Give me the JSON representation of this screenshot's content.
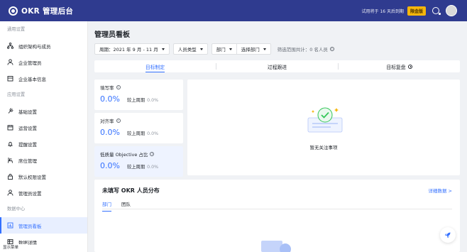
{
  "app": {
    "title": "OKR 管理后台",
    "trial_text": "试用将于 16 天后到期",
    "trial_badge": "限金版"
  },
  "sidebar": {
    "groups": [
      {
        "title": "通用设置",
        "items": [
          {
            "label": "组织架构与成员",
            "icon": "org-tree-icon"
          },
          {
            "label": "企业管理员",
            "icon": "user-icon"
          },
          {
            "label": "企业基本信息",
            "icon": "building-icon"
          }
        ]
      },
      {
        "title": "应用设置",
        "items": [
          {
            "label": "基础设置",
            "icon": "wrench-icon"
          },
          {
            "label": "运营设置",
            "icon": "calendar-icon"
          },
          {
            "label": "提醒设置",
            "icon": "bell-icon"
          },
          {
            "label": "席位管理",
            "icon": "seat-icon"
          },
          {
            "label": "默认权限设置",
            "icon": "lock-icon"
          },
          {
            "label": "管理员设置",
            "icon": "user-icon"
          }
        ]
      },
      {
        "title": "数据中心",
        "items": [
          {
            "label": "管理员看板",
            "icon": "chart-icon",
            "active": true
          },
          {
            "label": "数据详情",
            "icon": "table-icon"
          }
        ]
      }
    ],
    "footer": "显示菜单"
  },
  "main": {
    "title": "管理员看板",
    "filters": {
      "period": "周期：2021 年 9 月 - 11 月",
      "person_type": "人员类型",
      "dept": "部门",
      "select_dept": "选择部门",
      "scope": "筛选范围共计：0 名人员"
    },
    "tabs": [
      {
        "label": "目标制定",
        "active": true
      },
      {
        "label": "过程跟进"
      },
      {
        "label": "目标复盘"
      }
    ],
    "stats": [
      {
        "label": "填写率",
        "value": "0.0%",
        "compare": "较上周期",
        "compare_value": "0.0%"
      },
      {
        "label": "对齐率",
        "value": "0.0%",
        "compare": "较上周期",
        "compare_value": "0.0%"
      },
      {
        "label": "低质量 Objective 占比",
        "value": "0.0%",
        "compare": "较上周期",
        "compare_value": "0.0%"
      }
    ],
    "focus_empty": "暂无关注事项",
    "unfilled": {
      "title": "未填写 OKR 人员分布",
      "link": "详细数据 >",
      "tabs": [
        "部门",
        "团队"
      ]
    }
  },
  "colors": {
    "topbar": "#2f3b8f",
    "accent": "#3370ff",
    "badge": "#f5b60b",
    "active_bg": "#e8efff"
  }
}
